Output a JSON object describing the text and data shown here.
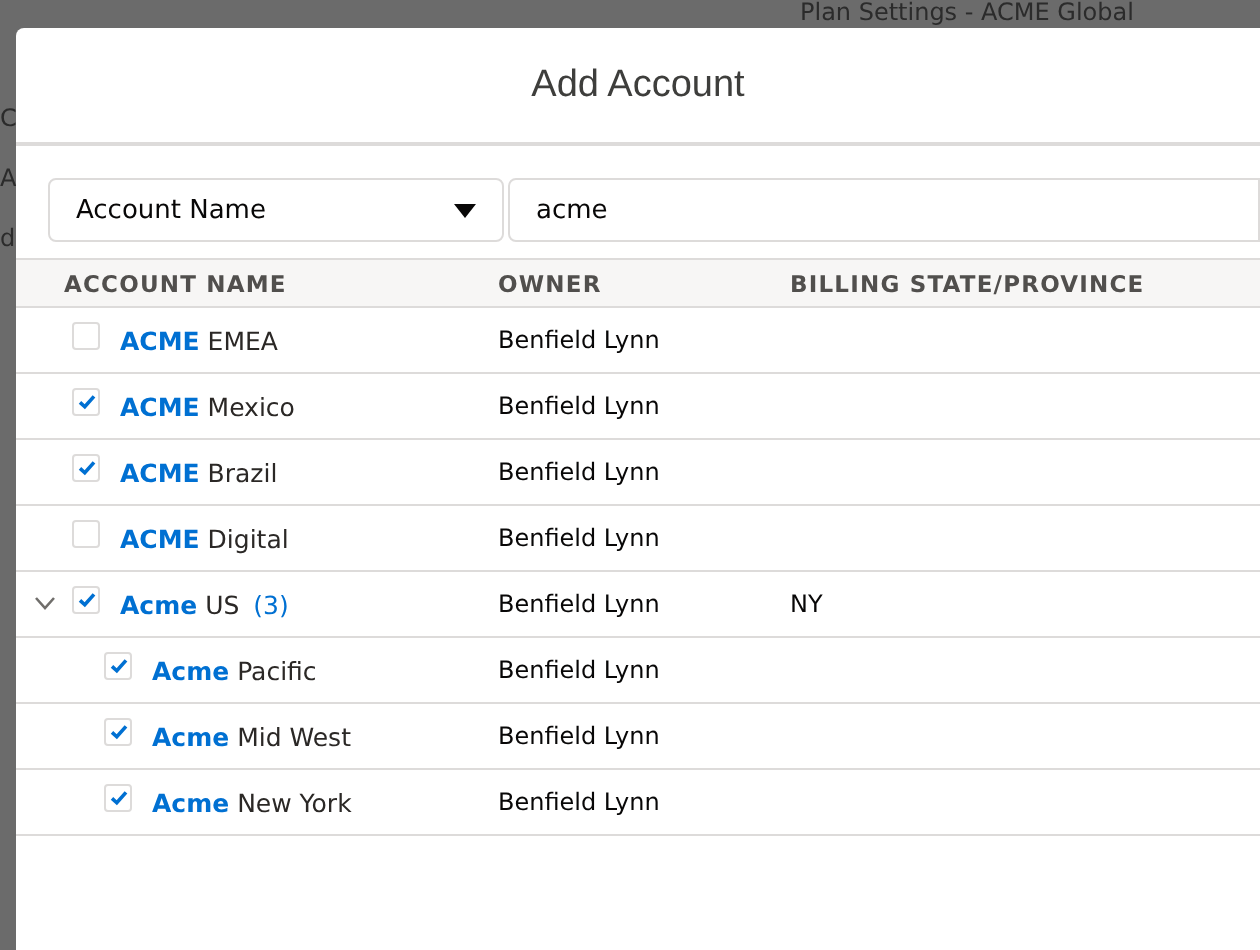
{
  "background": {
    "title": "Plan Settings - ACME Global",
    "fragments": [
      "C",
      "A",
      "d"
    ]
  },
  "modal": {
    "title": "Add Account"
  },
  "filter": {
    "field": "Account Name",
    "query": "acme"
  },
  "table": {
    "columns": [
      "ACCOUNT NAME",
      "OWNER",
      "BILLING STATE/PROVINCE"
    ],
    "rows": [
      {
        "name": "**ACME** EMEA",
        "checked": false,
        "owner": "Benfield Lynn"
      },
      {
        "name": "**ACME** Mexico",
        "checked": true,
        "owner": "Benfield Lynn"
      },
      {
        "name": "**ACME** Brazil",
        "checked": true,
        "owner": "Benfield Lynn"
      },
      {
        "name": "**ACME** Digital",
        "checked": false,
        "owner": "Benfield Lynn"
      },
      {
        "name": "**Acme** US",
        "count": "(3)",
        "checked": true,
        "expanded": true,
        "owner": "Benfield Lynn",
        "billing_state": "NY",
        "children": [
          {
            "name": "**Acme** Pacific",
            "checked": true,
            "owner": "Benfield Lynn"
          },
          {
            "name": "**Acme** Mid West",
            "checked": true,
            "owner": "Benfield Lynn"
          },
          {
            "name": "**Acme** New York",
            "checked": true,
            "owner": "Benfield Lynn"
          }
        ]
      }
    ]
  }
}
